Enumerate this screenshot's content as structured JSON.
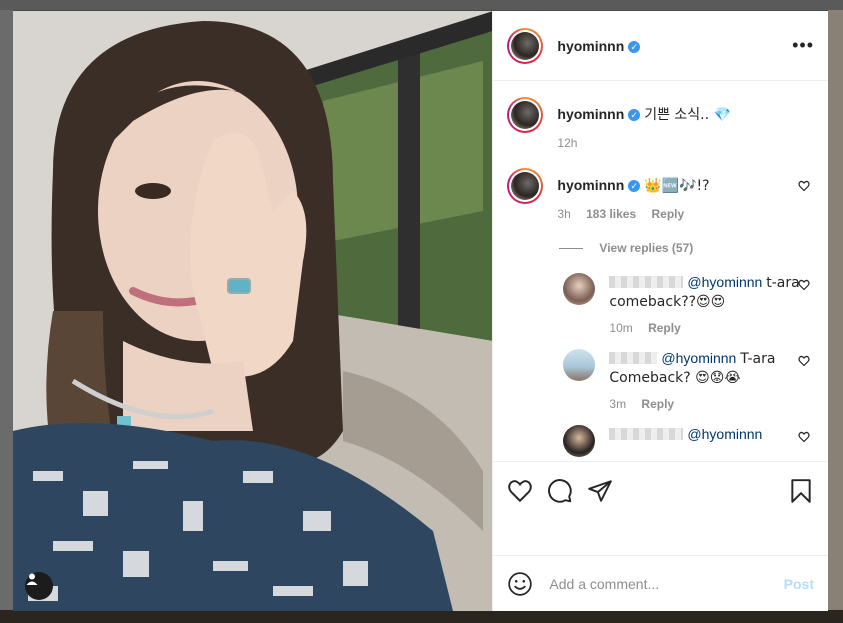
{
  "post": {
    "author": "hyominnn",
    "caption": {
      "username": "hyominnn",
      "text": "기쁜 소식.. 💎",
      "time": "12h"
    },
    "comments": [
      {
        "username": "hyominnn",
        "text": "👑🆕🎶!?",
        "time": "3h",
        "likes": "183 likes",
        "reply_label": "Reply",
        "view_replies": "View replies (57)",
        "replies": [
          {
            "mention": "@hyominnn",
            "text": "t-ara comeback??😍😍",
            "time": "10m",
            "reply_label": "Reply"
          },
          {
            "mention": "@hyominnn",
            "text": "T-ara Comeback? 😍😟😭",
            "time": "3m",
            "reply_label": "Reply"
          },
          {
            "mention": "@hyominnn",
            "text": "",
            "time": "",
            "reply_label": ""
          }
        ]
      }
    ],
    "add_comment_placeholder": "Add a comment...",
    "post_button": "Post"
  },
  "colors": {
    "verified": "#3897f0",
    "mention": "#00376b",
    "post_button_disabled": "#b2dffc"
  },
  "icons": [
    "more-options-icon",
    "heart-icon",
    "comment-icon",
    "share-icon",
    "bookmark-icon",
    "smiley-icon",
    "user-tag-icon",
    "verified-badge-icon"
  ]
}
